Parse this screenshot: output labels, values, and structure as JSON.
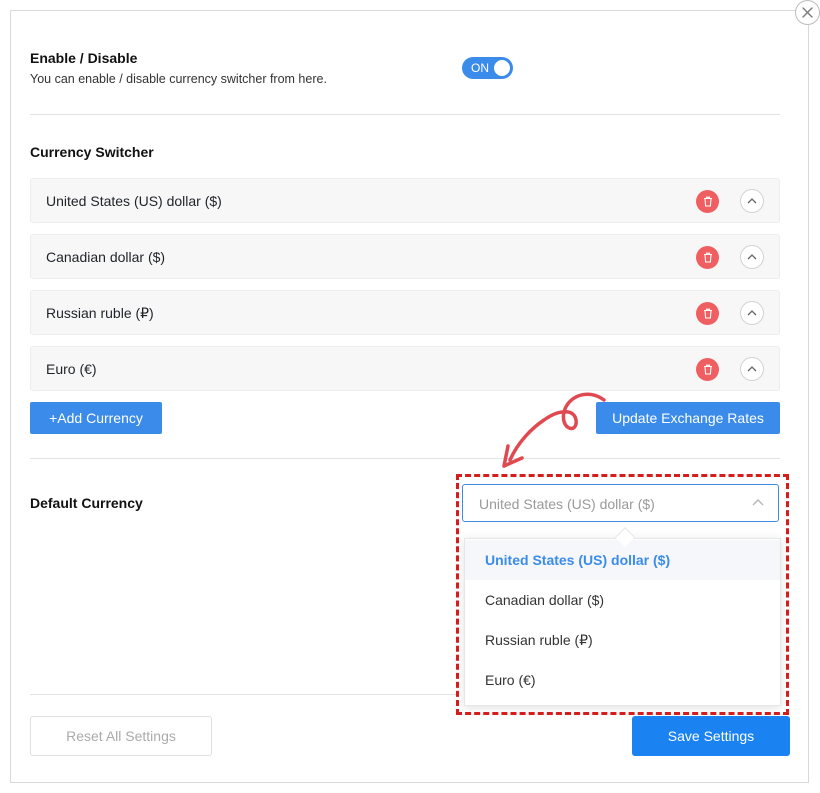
{
  "close_icon": "close-icon",
  "enable_section": {
    "title": "Enable / Disable",
    "description": "You can enable / disable currency switcher from here.",
    "toggle_label": "ON",
    "toggle_on": true
  },
  "currency_switcher": {
    "title": "Currency Switcher",
    "items": [
      {
        "name": "United States (US) dollar ($)"
      },
      {
        "name": "Canadian dollar ($)"
      },
      {
        "name": "Russian ruble (₽)"
      },
      {
        "name": "Euro (€)"
      }
    ],
    "add_button": "+Add Currency",
    "update_button": "Update Exchange Rates"
  },
  "default_currency": {
    "title": "Default Currency",
    "selected": "United States (US) dollar ($)",
    "options": [
      "United States (US) dollar ($)",
      "Canadian dollar ($)",
      "Russian ruble (₽)",
      "Euro (€)"
    ]
  },
  "footer": {
    "reset_button": "Reset All Settings",
    "save_button": "Save Settings"
  },
  "colors": {
    "accent": "#3b8beb",
    "save": "#1a82f1",
    "delete": "#ef5f62",
    "annotation": "#d61d1d",
    "arrow": "#e0494f"
  }
}
